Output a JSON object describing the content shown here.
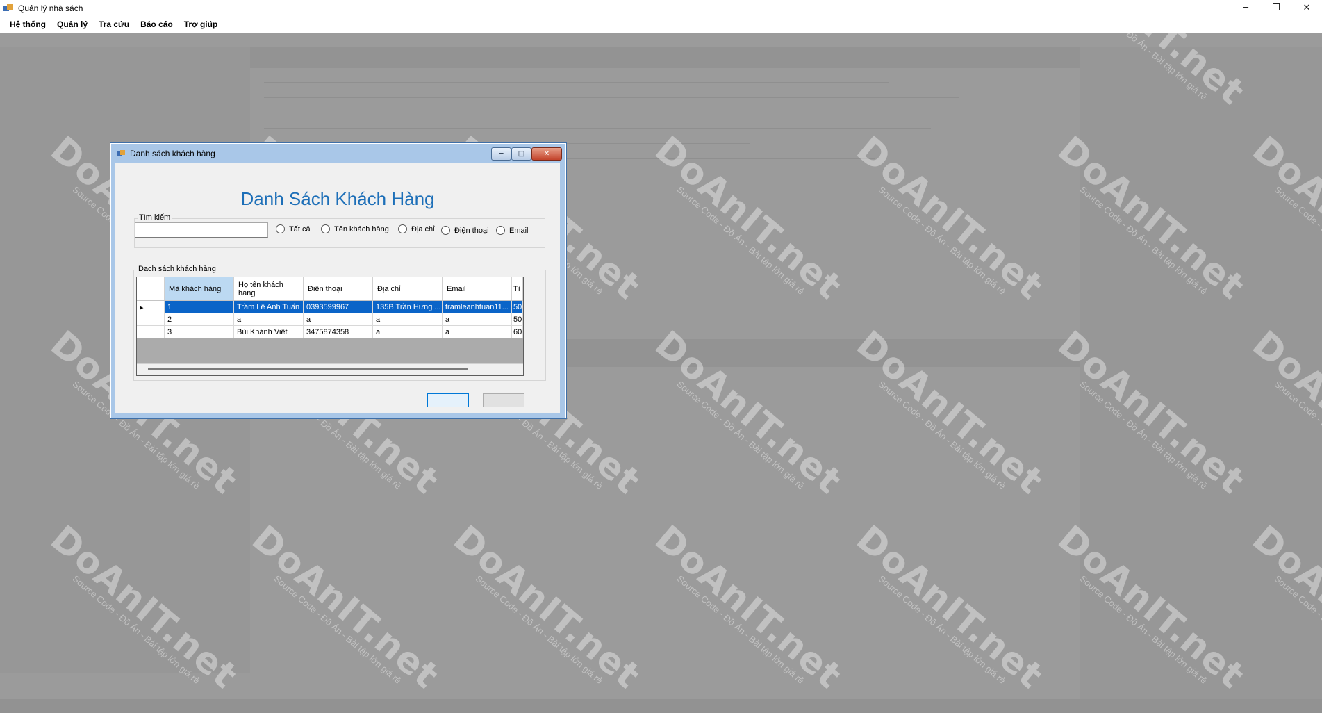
{
  "window": {
    "title": "Quản lý nhà sách",
    "controls": [
      "─",
      "❐",
      "✕"
    ]
  },
  "menu": {
    "items": [
      "Hệ thống",
      "Quản lý",
      "Tra cứu",
      "Báo cáo",
      "Trợ giúp"
    ]
  },
  "watermark": {
    "logo": "DoAnIT.net",
    "tagline": "Source Code - Đồ Án - Bài tập lớn giá rẻ"
  },
  "dialog": {
    "title": "Danh sách khách hàng",
    "heading": "Danh Sách Khách Hàng",
    "controls": {
      "min": "─",
      "max": "□",
      "close": "✕"
    },
    "search": {
      "group_label": "Tìm kiếm",
      "value": "",
      "options": [
        "Tất cả",
        "Tên khách hàng",
        "Địa chỉ",
        "Điện thoại",
        "Email"
      ]
    },
    "list": {
      "group_label": "Dach sách khách hàng",
      "columns": [
        "Mã khách hàng",
        "Họ tên khách hàng",
        "Điện thoại",
        "Địa chỉ",
        "Email",
        "Tì"
      ],
      "rows": [
        [
          "1",
          "Trầm Lê Anh Tuấn",
          "0393599967",
          "135B Trần Hưng ...",
          "tramleanhtuan11...",
          "50"
        ],
        [
          "2",
          "a",
          "a",
          "a",
          "a",
          "50"
        ],
        [
          "3",
          "Bùi Khánh Việt",
          "3475874358",
          "a",
          "a",
          "60"
        ]
      ],
      "selected_row": 0,
      "current_row_marker": "▸"
    },
    "buttons": {
      "ok": "",
      "cancel": ""
    }
  },
  "colors": {
    "heading": "#1d6fb8",
    "selection": "#0a64c8",
    "header_selected": "#bcd9f2"
  }
}
